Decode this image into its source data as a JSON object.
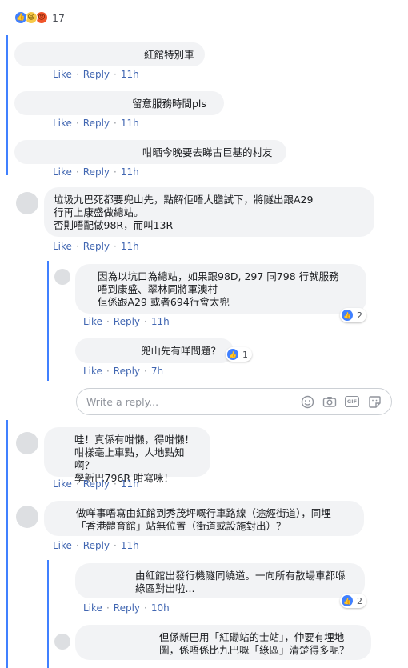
{
  "top_reactions": {
    "count": "17",
    "icons": [
      "like-icon",
      "haha-icon",
      "angry-icon"
    ]
  },
  "actions": {
    "like": "Like",
    "reply": "Reply",
    "sep": "·"
  },
  "comments": [
    {
      "text": "紅館特別車",
      "time": "11h"
    },
    {
      "text": "留意服務時間pls",
      "time": "11h"
    },
    {
      "text": "咁晒今晚要去睇古巨基的村友",
      "time": "11h"
    },
    {
      "text": "垃圾九巴死都要兜山先，點解佢唔大膽試下，將隧出跟A29\n行再上康盛做總站。\n否則唔配做98R，而叫13R",
      "time": "11h"
    },
    {
      "text": "因為以坑口為總站，如果跟98D, 297 同798 行就服務\n唔到康盛、翠林同將軍澳村\n但係跟A29 或者694行會太兜",
      "time": "11h",
      "reactions": "2"
    },
    {
      "text": "兜山先有咩問題？",
      "time": "7h",
      "reactions": "1"
    },
    {
      "text": "哇！真係有咁懶，得咁懶！\n咁樣毫上車點，人地點知啊？\n學新巴796R 咁寫咪！",
      "time": "11h"
    },
    {
      "text": "做咩事唔寫由紅館到秀茂坪嘅行車路線（途經街道），同埋\n「香港體育館」站無位置（街道或設施對出）？",
      "time": "11h"
    },
    {
      "text": "由紅館出發行機隧同繞道。一向所有散場車都喺\n綠區對出啦...",
      "time": "10h",
      "reactions": "2"
    },
    {
      "text": "但係新巴用「紅磡站的士站」，仲要有埋地\n圖，係唔係比九巴嘅「綠區」清楚得多呢？"
    }
  ],
  "reply_box": {
    "placeholder": "Write a reply...",
    "gif_label": "GIF"
  }
}
